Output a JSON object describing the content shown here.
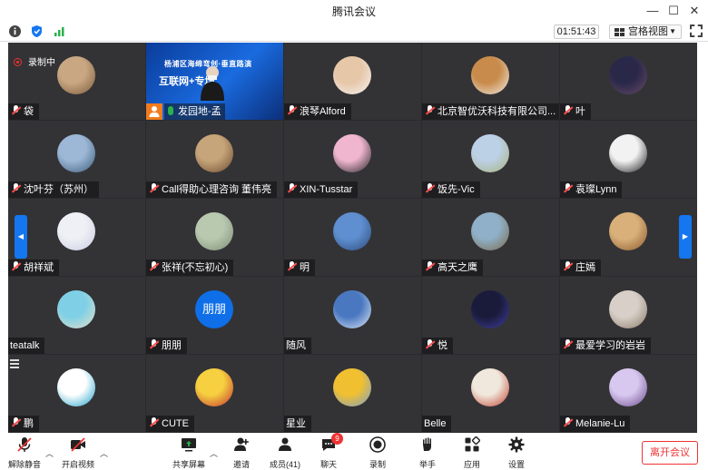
{
  "window": {
    "title": "腾讯会议",
    "minimize": "—",
    "maximize": "☐",
    "close": "✕"
  },
  "infobar": {
    "timer": "01:51:43",
    "view_label": "宫格视图"
  },
  "recording_label": "录制中",
  "share_tile": {
    "poster_line1": "杨浦区海绵弯创·垂直路演",
    "poster_line2": "互联网+专场",
    "name": "发园地-孟"
  },
  "participants": [
    {
      "name": "袋",
      "mic": true,
      "avatar": "woman-portrait",
      "c1": "#c9a783",
      "c2": "#7a5a3a"
    },
    {
      "name": "浪琴Alford",
      "mic": true,
      "avatar": "man-portrait",
      "c1": "#e6c7a8",
      "c2": "#f4f4f4"
    },
    {
      "name": "北京智优沃科技有限公司...",
      "mic": true,
      "avatar": "dog-portrait",
      "c1": "#c98b4b",
      "c2": "#f0eee8"
    },
    {
      "name": "叶",
      "mic": true,
      "avatar": "night-sky",
      "c1": "#2a2848",
      "c2": "#6a4a6a"
    },
    {
      "name": "沈叶芬（苏州）",
      "mic": true,
      "avatar": "sea-photo",
      "c1": "#9cb8d6",
      "c2": "#3d5a7a"
    },
    {
      "name": "Call得助心理咨询 董伟亮",
      "mic": true,
      "avatar": "long-hair-man",
      "c1": "#c7a57a",
      "c2": "#6b4a2e"
    },
    {
      "name": "XIN-Tusstar",
      "mic": true,
      "avatar": "cartoon-girl",
      "c1": "#f0b6d0",
      "c2": "#222222"
    },
    {
      "name": "饭先-Vic",
      "mic": true,
      "avatar": "field-photo",
      "c1": "#bcd0e6",
      "c2": "#a7b47a"
    },
    {
      "name": "袁璨Lynn",
      "mic": true,
      "avatar": "woman-black",
      "c1": "#f2f2f2",
      "c2": "#1a1a1a"
    },
    {
      "name": "胡祥斌",
      "mic": true,
      "avatar": "cartoon-bear",
      "c1": "#eef0f6",
      "c2": "#c9cde0"
    },
    {
      "name": "张祥(不忘初心)",
      "mic": true,
      "avatar": "outdoor-photo",
      "c1": "#b9c9b0",
      "c2": "#7d8c74"
    },
    {
      "name": "明",
      "mic": true,
      "avatar": "lake-photo",
      "c1": "#5f8fd0",
      "c2": "#2c4a7a"
    },
    {
      "name": "高天之鹰",
      "mic": true,
      "avatar": "landscape-photo",
      "c1": "#8fb0c8",
      "c2": "#7a6a4a"
    },
    {
      "name": "庄嫣",
      "mic": true,
      "avatar": "puppy-photo",
      "c1": "#d9b07a",
      "c2": "#8a5a2e"
    },
    {
      "name": "teatalk",
      "mic": false,
      "avatar": "beach-photo",
      "c1": "#7fd0e6",
      "c2": "#e8e0c8"
    },
    {
      "name": "朋朋",
      "mic": true,
      "avatar": "text-avatar",
      "avatar_text": "朋朋",
      "c1": "#0f6fe8",
      "c2": "#0f6fe8"
    },
    {
      "name": "随风",
      "mic": false,
      "avatar": "plane-sky",
      "c1": "#4a78c0",
      "c2": "#dfe9f6"
    },
    {
      "name": "悦",
      "mic": true,
      "avatar": "night-lights",
      "c1": "#1a1a3a",
      "c2": "#4040a0"
    },
    {
      "name": "最爱学习的岩岩",
      "mic": true,
      "avatar": "cat-photo",
      "c1": "#d8d0c8",
      "c2": "#8a7a6a"
    },
    {
      "name": "鹏",
      "mic": true,
      "avatar": "company-logo",
      "c1": "#ffffff",
      "c2": "#1aa0c8"
    },
    {
      "name": "CUTE",
      "mic": true,
      "avatar": "cartoon-face",
      "c1": "#f6d040",
      "c2": "#c03030"
    },
    {
      "name": "星业",
      "mic": false,
      "avatar": "flowers-photo",
      "c1": "#f0c030",
      "c2": "#7aa0d0"
    },
    {
      "name": "Belle",
      "mic": false,
      "avatar": "sketch-girl",
      "c1": "#f0e8dc",
      "c2": "#c04030"
    },
    {
      "name": "Melanie-Lu",
      "mic": true,
      "avatar": "woman-photo",
      "c1": "#d8c8f0",
      "c2": "#6a4a8a"
    }
  ],
  "toolbar": {
    "unmute": "解除静音",
    "start_video": "开启视频",
    "share_screen": "共享屏幕",
    "invite": "邀请",
    "members": "成员(41)",
    "chat": "聊天",
    "chat_badge": "9",
    "record": "录制",
    "raise_hand": "举手",
    "apps": "应用",
    "settings": "设置",
    "leave": "离开会议"
  },
  "colors": {
    "accent": "#1477f0",
    "danger": "#e33333",
    "share": "#f07c1e",
    "grid_bg": "#333336"
  }
}
